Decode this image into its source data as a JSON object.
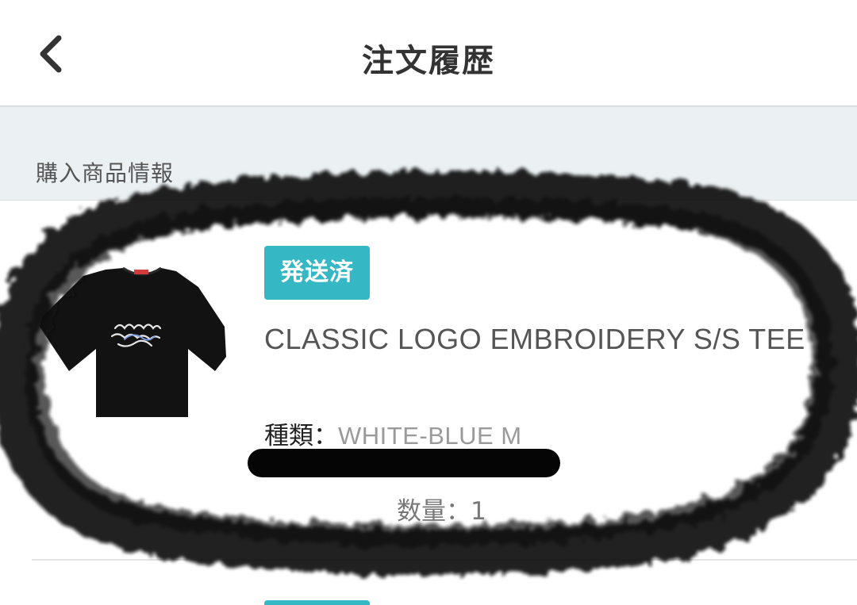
{
  "header": {
    "title": "注文履歴",
    "back_icon": "chevron-left-icon"
  },
  "section": {
    "label": "購入商品情報"
  },
  "order_item": {
    "status": "発送済",
    "product_name": "CLASSIC LOGO EMBROIDERY S/S TEE",
    "variant_key": "種類：",
    "variant_value": "WHITE-BLUE M",
    "quantity_text": "数量：1",
    "thumbnail_icon": "tshirt-image"
  },
  "colors": {
    "accent": "#36b7c4",
    "section_bg": "#ebf0f2",
    "title_text": "#333333"
  }
}
